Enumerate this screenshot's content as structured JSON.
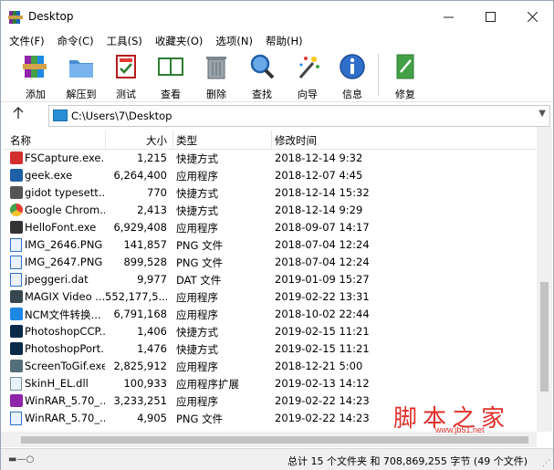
{
  "window": {
    "title": "Desktop"
  },
  "menu": [
    "文件(F)",
    "命令(C)",
    "工具(S)",
    "收藏夹(O)",
    "选项(N)",
    "帮助(H)"
  ],
  "toolbar": [
    {
      "label": "添加",
      "icon": "add-archive-icon"
    },
    {
      "label": "解压到",
      "icon": "extract-to-icon"
    },
    {
      "label": "测试",
      "icon": "test-icon"
    },
    {
      "label": "查看",
      "icon": "view-book-icon"
    },
    {
      "label": "删除",
      "icon": "delete-trash-icon"
    },
    {
      "label": "查找",
      "icon": "find-magnifier-icon"
    },
    {
      "label": "向导",
      "icon": "wizard-wand-icon"
    },
    {
      "label": "信息",
      "icon": "info-icon"
    },
    {
      "label": "修复",
      "icon": "repair-icon"
    }
  ],
  "address": {
    "path": "C:\\Users\\7\\Desktop"
  },
  "columns": {
    "name": "名称",
    "size": "大小",
    "type": "类型",
    "modified": "修改时间"
  },
  "files": [
    {
      "name": "FSCapture.exe....",
      "size": "1,215",
      "type": "快捷方式",
      "modified": "2018-12-14 9:32",
      "icon": "fscapture-shortcut-icon"
    },
    {
      "name": "geek.exe",
      "size": "6,264,400",
      "type": "应用程序",
      "modified": "2018-12-07 4:45",
      "icon": "geek-app-icon"
    },
    {
      "name": "gidot typesett...",
      "size": "770",
      "type": "快捷方式",
      "modified": "2018-12-14 15:32",
      "icon": "gidot-shortcut-icon"
    },
    {
      "name": "Google Chrom...",
      "size": "2,413",
      "type": "快捷方式",
      "modified": "2018-12-14 9:29",
      "icon": "chrome-icon"
    },
    {
      "name": "HelloFont.exe",
      "size": "6,929,408",
      "type": "应用程序",
      "modified": "2018-09-07 14:17",
      "icon": "hellofont-pen-icon"
    },
    {
      "name": "IMG_2646.PNG",
      "size": "141,857",
      "type": "PNG 文件",
      "modified": "2018-07-04 12:24",
      "icon": "png-file-icon"
    },
    {
      "name": "IMG_2647.PNG",
      "size": "899,528",
      "type": "PNG 文件",
      "modified": "2018-07-04 12:24",
      "icon": "png-file-icon"
    },
    {
      "name": "jpeggeri.dat",
      "size": "9,977",
      "type": "DAT 文件",
      "modified": "2019-01-09 15:27",
      "icon": "dat-file-icon"
    },
    {
      "name": "MAGIX Video ...",
      "size": "552,177,5...",
      "type": "应用程序",
      "modified": "2019-02-22 13:31",
      "icon": "magix-app-icon"
    },
    {
      "name": "NCM文件转换...",
      "size": "6,791,168",
      "type": "应用程序",
      "modified": "2018-10-02 22:44",
      "icon": "ncm-converter-icon"
    },
    {
      "name": "PhotoshopCCP...",
      "size": "1,406",
      "type": "快捷方式",
      "modified": "2019-02-15 11:21",
      "icon": "photoshop-icon"
    },
    {
      "name": "PhotoshopPort...",
      "size": "1,476",
      "type": "快捷方式",
      "modified": "2019-02-15 11:21",
      "icon": "photoshop-icon"
    },
    {
      "name": "ScreenToGif.exe",
      "size": "2,825,912",
      "type": "应用程序",
      "modified": "2018-12-21 5:00",
      "icon": "screentogif-icon"
    },
    {
      "name": "SkinH_EL.dll",
      "size": "100,933",
      "type": "应用程序扩展",
      "modified": "2019-02-13 14:12",
      "icon": "dll-file-icon"
    },
    {
      "name": "WinRAR_5.70_...",
      "size": "3,233,251",
      "type": "应用程序",
      "modified": "2019-02-22 14:23",
      "icon": "winrar-app-icon"
    },
    {
      "name": "WinRAR_5.70_...",
      "size": "4,905",
      "type": "PNG 文件",
      "modified": "2019-02-22 14:23",
      "icon": "png-file-icon"
    }
  ],
  "status": {
    "text": "总计 15 个文件夹 和 708,869,255 字节 (49 个文件)"
  },
  "watermark": {
    "cn": "脚本之家",
    "url": "www.jb51.net"
  }
}
